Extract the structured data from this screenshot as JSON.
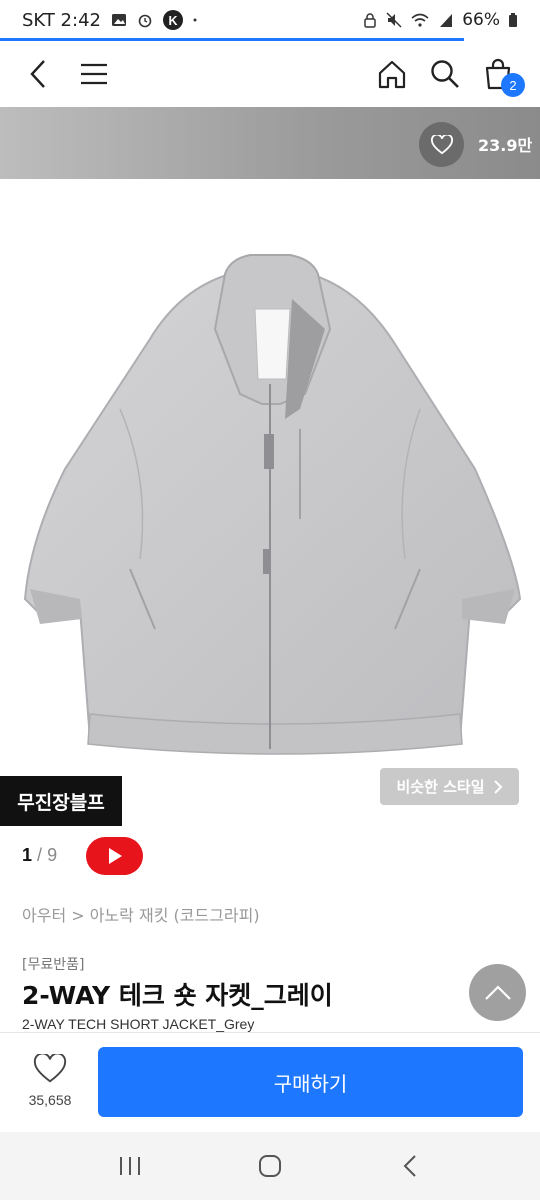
{
  "status_bar": {
    "carrier_time": "SKT 2:42",
    "battery": "66%",
    "icons": [
      "gallery-icon",
      "alarm-icon",
      "k-app-icon",
      "dot-icon",
      "lock-icon",
      "mute-icon",
      "wifi-icon",
      "signal-icon",
      "battery-icon"
    ]
  },
  "page_loading_progress": 0.86,
  "nav": {
    "back_icon": "chevron-left-icon",
    "menu_icon": "hamburger-icon",
    "home_icon": "home-icon",
    "search_icon": "search-icon",
    "cart_icon": "bag-icon",
    "cart_count": "2"
  },
  "hero": {
    "like_count": "23.9만"
  },
  "product_image": {
    "brand_tag": "무진장블프",
    "similar_style_label": "비슷한 스타일",
    "colors": {
      "jacket": "#c9c9cb",
      "jacket_shadow": "#a9a9ac"
    }
  },
  "pager": {
    "current": "1",
    "separator": "/",
    "total": "9"
  },
  "product": {
    "breadcrumb": "아우터 > 아노락 재킷 (코드그라피)",
    "badge": "[무료반품]",
    "title": "2-WAY 테크 숏 자켓_그레이",
    "subtitle": "2-WAY TECH SHORT JACKET_Grey"
  },
  "bottom_bar": {
    "wish_count": "35,658",
    "buy_label": "구매하기"
  },
  "colors": {
    "accent": "#1e78ff",
    "youtube": "#e8141b"
  }
}
